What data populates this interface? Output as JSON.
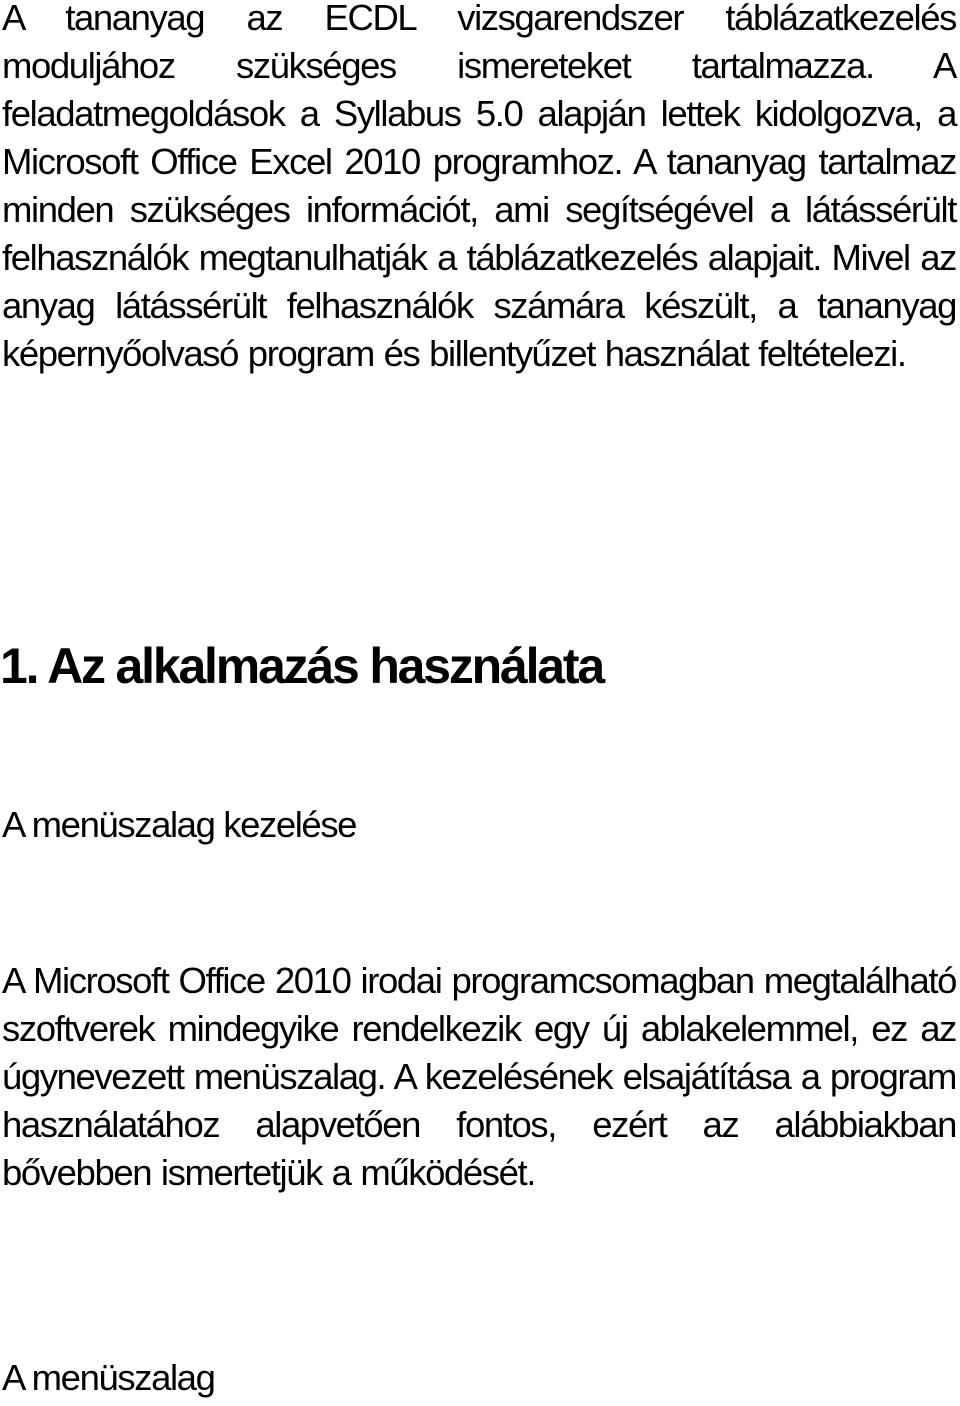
{
  "document": {
    "intro_paragraph": "A tananyag az ECDL vizsgarendszer táblázatkezelés moduljához szükséges ismereteket tartalmazza. A feladatmegoldások a Syllabus 5.0 alapján lettek kidolgozva, a Microsoft Office Excel 2010 programhoz. A tananyag tartalmaz minden szükséges információt, ami segítségével a látássérült felhasználók megtanulhatják a táblázatkezelés alapjait. Mivel az anyag látássérült felhasználók számára készült, a tananyag képernyőolvasó program és billentyűzet használat feltételezi.",
    "section_heading": "1. Az alkalmazás használata",
    "subsection_1_heading": "A menüszalag kezelése",
    "subsection_1_paragraph": "A Microsoft Office 2010 irodai programcsomagban megtalálható szoftverek mindegyike rendelkezik egy új ablakelemmel, ez az úgynevezett menüszalag. A kezelésének elsajátítása a program használatához alapvetően fontos, ezért az alábbiakban bővebben ismertetjük a működését.",
    "subsection_2_heading": "A menüszalag"
  }
}
